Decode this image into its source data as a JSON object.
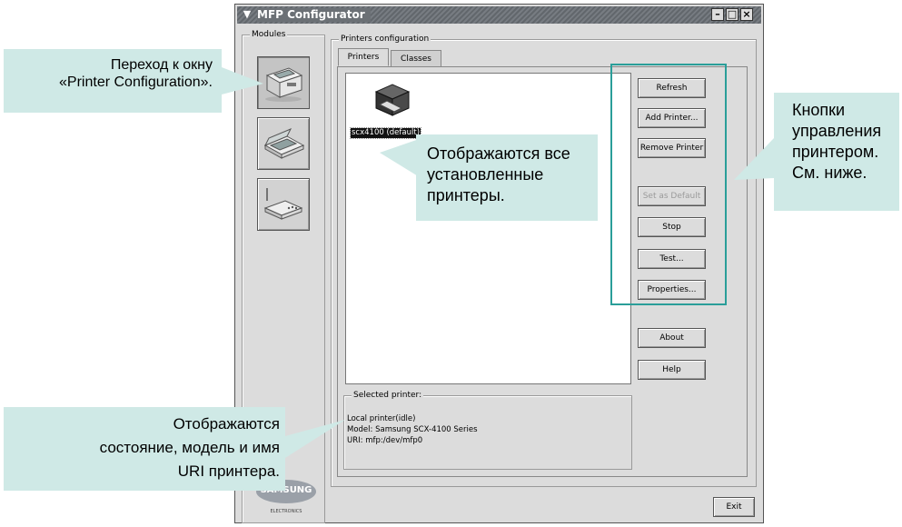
{
  "window": {
    "title": "MFP Configurator",
    "minimize_glyph": "–",
    "maximize_glyph": "□",
    "close_glyph": "×",
    "menu_glyph": "▼"
  },
  "modules": {
    "label": "Modules",
    "items": [
      {
        "name": "printer-module",
        "icon": "printer-icon",
        "active": true
      },
      {
        "name": "scanner-module",
        "icon": "scanner-icon",
        "active": false
      },
      {
        "name": "ports-module",
        "icon": "port-device-icon",
        "active": false
      }
    ],
    "logo_text": "SAMSUNG",
    "logo_subtext": "ELECTRONICS"
  },
  "printers_config": {
    "label": "Printers configuration",
    "tabs": [
      {
        "label": "Printers",
        "active": true
      },
      {
        "label": "Classes",
        "active": false
      }
    ],
    "printer_list": [
      {
        "label": "scx4100 (default)",
        "selected": true
      }
    ],
    "buttons": {
      "refresh": "Refresh",
      "add_printer": "Add Printer...",
      "remove_printer": "Remove Printer",
      "set_default": "Set as Default",
      "stop": "Stop",
      "test": "Test...",
      "properties": "Properties...",
      "about": "About",
      "help": "Help",
      "exit": "Exit"
    },
    "selected_printer": {
      "label": "Selected printer:",
      "status": "Local printer(idle)",
      "model": "Model: Samsung SCX-4100 Series",
      "uri": "URI: mfp:/dev/mfp0"
    }
  },
  "callouts": {
    "goto_printer_config": {
      "line1": "Переход к окну",
      "line2": "«Printer Configuration»."
    },
    "all_printers": {
      "line1": "Отображаются все",
      "line2": "установленные",
      "line3": "принтеры."
    },
    "printer_buttons": {
      "line1": "Кнопки",
      "line2": "управления",
      "line3": "принтером.",
      "line4": "См. ниже."
    },
    "status_info": {
      "line1": "Отображаются",
      "line2": "состояние, модель и имя",
      "line3": "URI принтера."
    }
  },
  "colors": {
    "callout_bg": "#cfe9e6",
    "highlight_frame": "#2a9e99",
    "titlebar": "#6b7075"
  }
}
